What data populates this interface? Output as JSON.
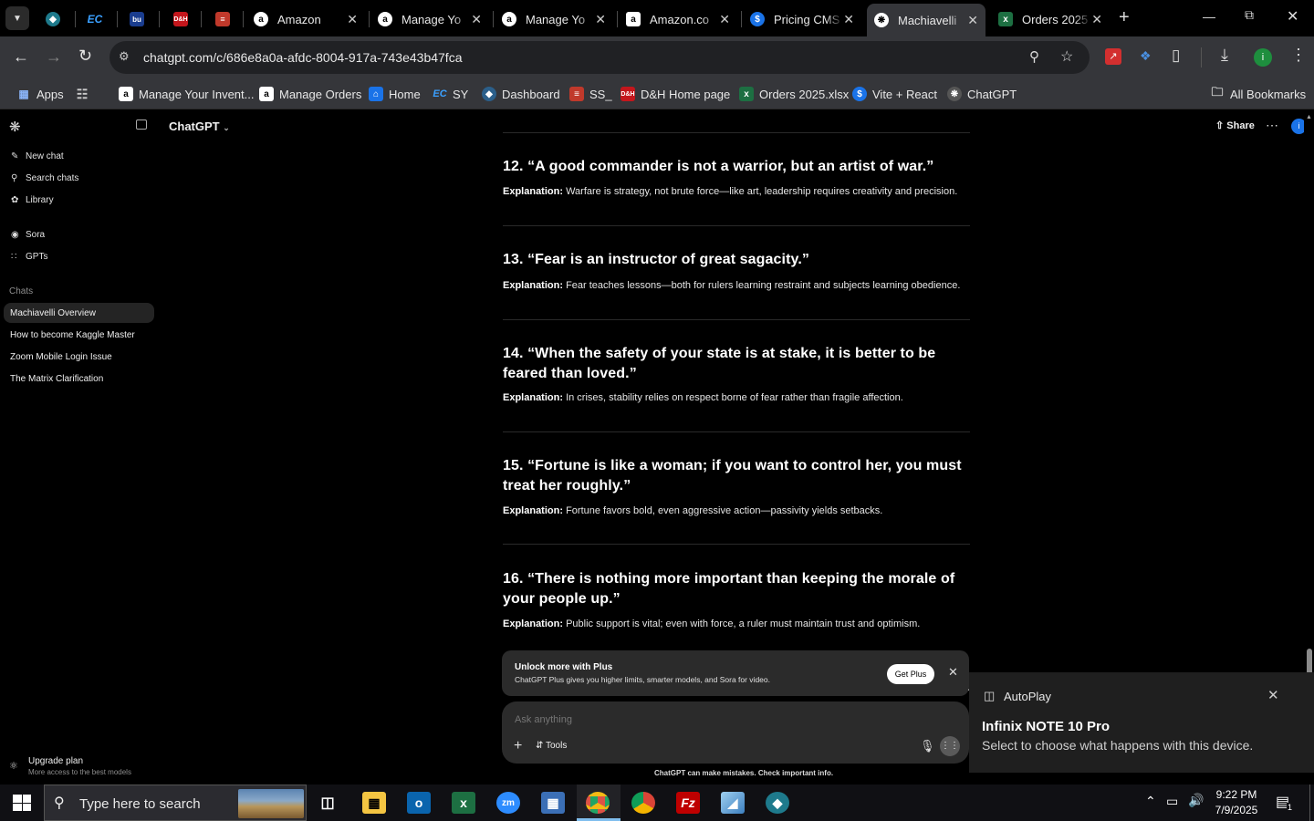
{
  "browser": {
    "tabs": [
      {
        "title": "",
        "icon": "edge-icon"
      },
      {
        "title": "",
        "icon": "ec-icon"
      },
      {
        "title": "",
        "icon": "bu-icon"
      },
      {
        "title": "",
        "icon": "dh-icon"
      },
      {
        "title": "",
        "icon": "stack-icon"
      },
      {
        "title": "Amazon",
        "icon": "amazon-icon"
      },
      {
        "title": "Manage Yo",
        "icon": "amazon-icon"
      },
      {
        "title": "Manage Yo",
        "icon": "amazon-icon"
      },
      {
        "title": "Amazon.co",
        "icon": "amazon-icon"
      },
      {
        "title": "Pricing CMS",
        "icon": "dollar-icon"
      },
      {
        "title": "Machiavelli",
        "icon": "chatgpt-icon"
      },
      {
        "title": "Orders 2025",
        "icon": "excel-icon"
      }
    ],
    "url": "chatgpt.com/c/686e8a0a-afdc-8004-917a-743e43b47fca",
    "bookmarks": [
      "Apps",
      "Manage Your Invent...",
      "Manage Orders",
      "Home",
      "SY",
      "Dashboard",
      "SS_",
      "D&H Home page",
      "Orders 2025.xlsx",
      "Vite + React",
      "ChatGPT"
    ],
    "all_bookmarks": "All Bookmarks",
    "profile_initial": "i"
  },
  "sidebar": {
    "nav": [
      "New chat",
      "Search chats",
      "Library",
      "Sora",
      "GPTs"
    ],
    "chats_label": "Chats",
    "chats": [
      "Machiavelli Overview",
      "How to become Kaggle Master",
      "Zoom Mobile Login Issue",
      "The Matrix Clarification"
    ],
    "upgrade_title": "Upgrade plan",
    "upgrade_sub": "More access to the best models"
  },
  "header": {
    "model": "ChatGPT",
    "share": "Share"
  },
  "quotes": [
    {
      "title": "12. “A good commander is not a warrior, but an artist of war.”",
      "label": "Explanation:",
      "text": " Warfare is strategy, not brute force—like art, leadership requires creativity and precision."
    },
    {
      "title": "13. “Fear is an instructor of great sagacity.”",
      "label": "Explanation:",
      "text": " Fear teaches lessons—both for rulers learning restraint and subjects learning obedience."
    },
    {
      "title": "14. “When the safety of your state is at stake, it is better to be feared than loved.”",
      "label": "Explanation:",
      "text": " In crises, stability relies on respect borne of fear rather than fragile affection."
    },
    {
      "title": "15. “Fortune is like a woman; if you want to control her, you must treat her roughly.”",
      "label": "Explanation:",
      "text": " Fortune favors bold, even aggressive action—passivity yields setbacks."
    },
    {
      "title": "16. “There is nothing more important than keeping the morale of your people up.”",
      "label": "Explanation:",
      "text": " Public support is vital; even with force, a ruler must maintain trust and optimism."
    }
  ],
  "upsell": {
    "title": "Unlock more with Plus",
    "body": "ChatGPT Plus gives you higher limits, smarter models, and Sora for video.",
    "button": "Get Plus"
  },
  "composer": {
    "placeholder": "Ask anything",
    "tools": "Tools",
    "disclaimer": "ChatGPT can make mistakes. Check important info."
  },
  "autoplay": {
    "heading": "AutoPlay",
    "device": "Infinix NOTE 10 Pro",
    "message": "Select to choose what happens with this device."
  },
  "taskbar": {
    "search_placeholder": "Type here to search",
    "time": "9:22 PM",
    "date": "7/9/2025",
    "notification_count": "1"
  }
}
